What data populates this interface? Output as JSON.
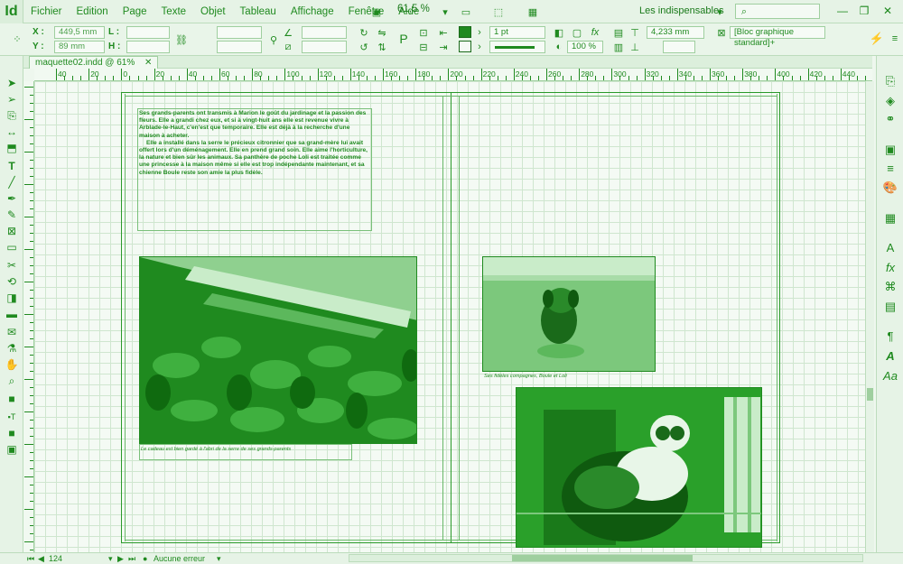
{
  "app": {
    "logo": "Id"
  },
  "menu": [
    "Fichier",
    "Edition",
    "Page",
    "Texte",
    "Objet",
    "Tableau",
    "Affichage",
    "Fenêtre",
    "Aide"
  ],
  "zoom": "61,5 %",
  "workspace": "Les indispensables",
  "control": {
    "x_label": "X :",
    "x_value": "449,5 mm",
    "y_label": "Y :",
    "y_value": "89 mm",
    "l_label": "L :",
    "h_label": "H :",
    "stroke_weight": "1 pt",
    "opacity": "100 %",
    "dimension": "4,233 mm",
    "object_style": "[Bloc graphique standard]+"
  },
  "document": {
    "tab": "maquette02.indd @ 61%"
  },
  "ruler": {
    "labels": [
      "40",
      "20",
      "0",
      "20",
      "40",
      "60",
      "80",
      "100",
      "120",
      "140",
      "160",
      "180",
      "200",
      "220",
      "240",
      "260",
      "280",
      "300",
      "320",
      "340",
      "360",
      "380",
      "400",
      "420",
      "440"
    ]
  },
  "content": {
    "paragraph1": "Ses grands-parents ont transmis à Marion le goût du jardinage et la passion des fleurs. Elle a grandi chez eux, et si à vingt-huit ans elle est revenue vivre à Arblade-le-Haut, c'en'est que temporaire. Elle est déjà à la recherche d'une maison à acheter.",
    "paragraph2": "Elle a installé dans la serre le précieux citronnier que sa grand-mère lui avait offert lors d'un déménagement. Elle en prend grand soin. Elle aime l'horticulture, la nature et bien sûr les animaux. Sa panthère de poche Loli est traitée comme une princesse à la maison même si elle est trop indépendante maintenant, et sa chienne Boule reste son amie la plus fidèle.",
    "caption_left": "Le cadeau est bien gardé à l'abri de la serre de ses grands-parents",
    "caption_right": "Ses fidèles compagnes, Boule et Loli"
  },
  "status": {
    "page": "124",
    "errors": "Aucune erreur"
  },
  "colors": {
    "accent": "#1f8a1f",
    "background": "#eef7ee"
  }
}
